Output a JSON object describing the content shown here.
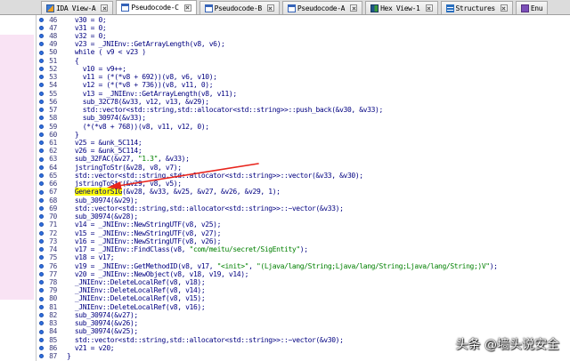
{
  "tabs": [
    {
      "label": "IDA View-A",
      "icon": "ida-view-icon",
      "active": false,
      "closable": true
    },
    {
      "label": "Pseudocode-C",
      "icon": "pseudocode-icon",
      "active": true,
      "closable": true
    },
    {
      "label": "Pseudocode-B",
      "icon": "pseudocode-icon",
      "active": false,
      "closable": true
    },
    {
      "label": "Pseudocode-A",
      "icon": "pseudocode-icon",
      "active": false,
      "closable": true
    },
    {
      "label": "Hex View-1",
      "icon": "hex-view-icon",
      "active": false,
      "closable": true
    },
    {
      "label": "Structures",
      "icon": "structures-icon",
      "active": false,
      "closable": true
    },
    {
      "label": "Enu",
      "icon": "enums-icon",
      "active": false,
      "closable": false
    }
  ],
  "colors": {
    "code_text": "#000080",
    "line_number": "#3c3c7c",
    "string": "#008000",
    "identifier_highlight": "#ffff00",
    "statement_dot": "#2f6fde",
    "annotation_arrow": "#e8241c",
    "active_tab": "#ffffff"
  },
  "code": {
    "lines": [
      {
        "n": "46",
        "segs": [
          {
            "t": "  v30 = 0;"
          }
        ]
      },
      {
        "n": "47",
        "segs": [
          {
            "t": "  v31 = 0;"
          }
        ]
      },
      {
        "n": "48",
        "segs": [
          {
            "t": "  v32 = 0;"
          }
        ]
      },
      {
        "n": "49",
        "segs": [
          {
            "t": "  v23 = _JNIEnv::GetArrayLength(v8, v6);"
          }
        ]
      },
      {
        "n": "50",
        "segs": [
          {
            "t": "  while ( v9 < v23 )"
          }
        ]
      },
      {
        "n": "51",
        "segs": [
          {
            "t": "  {"
          }
        ]
      },
      {
        "n": "52",
        "segs": [
          {
            "t": "    v10 = v9++;"
          }
        ]
      },
      {
        "n": "53",
        "segs": [
          {
            "t": "    v11 = (*(*v8 + 692))(v8, v6, v10);"
          }
        ]
      },
      {
        "n": "54",
        "segs": [
          {
            "t": "    v12 = (*(*v8 + 736))(v8, v11, 0);"
          }
        ]
      },
      {
        "n": "55",
        "segs": [
          {
            "t": "    v13 = _JNIEnv::GetArrayLength(v8, v11);"
          }
        ]
      },
      {
        "n": "56",
        "segs": [
          {
            "t": "    sub_32C78(&v33, v12, v13, &v29);"
          }
        ]
      },
      {
        "n": "57",
        "segs": [
          {
            "t": "    std::vector<std::string,std::allocator<std::string>>::push_back(&v30, &v33);"
          }
        ]
      },
      {
        "n": "58",
        "segs": [
          {
            "t": "    sub_30974(&v33);"
          }
        ]
      },
      {
        "n": "59",
        "segs": [
          {
            "t": "    (*(*v8 + 768))(v8, v11, v12, 0);"
          }
        ]
      },
      {
        "n": "60",
        "segs": [
          {
            "t": "  }"
          }
        ]
      },
      {
        "n": "61",
        "segs": [
          {
            "t": "  v25 = &unk_5C114;"
          }
        ]
      },
      {
        "n": "62",
        "segs": [
          {
            "t": "  v26 = &unk_5C114;"
          }
        ]
      },
      {
        "n": "63",
        "segs": [
          {
            "t": "  sub_32FAC(&v27, "
          },
          {
            "t": "\"1.3\"",
            "kind": "string"
          },
          {
            "t": ", &v33);"
          }
        ]
      },
      {
        "n": "64",
        "segs": [
          {
            "t": "  jstringToStr(&v28, v8, v7);"
          }
        ]
      },
      {
        "n": "65",
        "segs": [
          {
            "t": "  std::vector<std::string,std::allocator<std::string>>::vector(&v33, &v30);"
          }
        ]
      },
      {
        "n": "66",
        "segs": [
          {
            "t": "  jstringToStr(&v29, v8, v5);"
          }
        ]
      },
      {
        "n": "67",
        "segs": [
          {
            "t": "  "
          },
          {
            "t": "GeneratorSIG",
            "kind": "highlight"
          },
          {
            "t": "(&v28, &v33, &v25, &v27, &v26, &v29, 1);"
          }
        ]
      },
      {
        "n": "68",
        "segs": [
          {
            "t": "  sub_30974(&v29);"
          }
        ]
      },
      {
        "n": "69",
        "segs": [
          {
            "t": "  std::vector<std::string,std::allocator<std::string>>::~vector(&v33);"
          }
        ]
      },
      {
        "n": "70",
        "segs": [
          {
            "t": "  sub_30974(&v28);"
          }
        ]
      },
      {
        "n": "71",
        "segs": [
          {
            "t": "  v14 = _JNIEnv::NewStringUTF(v8, v25);"
          }
        ]
      },
      {
        "n": "72",
        "segs": [
          {
            "t": "  v15 = _JNIEnv::NewStringUTF(v8, v27);"
          }
        ]
      },
      {
        "n": "73",
        "segs": [
          {
            "t": "  v16 = _JNIEnv::NewStringUTF(v8, v26);"
          }
        ]
      },
      {
        "n": "74",
        "segs": [
          {
            "t": "  v17 = _JNIEnv::FindClass(v8, "
          },
          {
            "t": "\"com/meitu/secret/SigEntity\"",
            "kind": "string"
          },
          {
            "t": ");"
          }
        ]
      },
      {
        "n": "75",
        "segs": [
          {
            "t": "  v18 = v17;"
          }
        ]
      },
      {
        "n": "76",
        "segs": [
          {
            "t": "  v19 = _JNIEnv::GetMethodID(v8, v17, "
          },
          {
            "t": "\"<init>\"",
            "kind": "string"
          },
          {
            "t": ", "
          },
          {
            "t": "\"(Ljava/lang/String;Ljava/lang/String;Ljava/lang/String;)V\"",
            "kind": "string"
          },
          {
            "t": ");"
          }
        ]
      },
      {
        "n": "77",
        "segs": [
          {
            "t": "  v20 = _JNIEnv::NewObject(v8, v18, v19, v14);"
          }
        ]
      },
      {
        "n": "78",
        "segs": [
          {
            "t": "  _JNIEnv::DeleteLocalRef(v8, v18);"
          }
        ]
      },
      {
        "n": "79",
        "segs": [
          {
            "t": "  _JNIEnv::DeleteLocalRef(v8, v14);"
          }
        ]
      },
      {
        "n": "80",
        "segs": [
          {
            "t": "  _JNIEnv::DeleteLocalRef(v8, v15);"
          }
        ]
      },
      {
        "n": "81",
        "segs": [
          {
            "t": "  _JNIEnv::DeleteLocalRef(v8, v16);"
          }
        ]
      },
      {
        "n": "82",
        "segs": [
          {
            "t": "  sub_30974(&v27);"
          }
        ]
      },
      {
        "n": "83",
        "segs": [
          {
            "t": "  sub_30974(&v26);"
          }
        ]
      },
      {
        "n": "84",
        "segs": [
          {
            "t": "  sub_30974(&v25);"
          }
        ]
      },
      {
        "n": "85",
        "segs": [
          {
            "t": "  std::vector<std::string,std::allocator<std::string>>::~vector(&v30);"
          }
        ]
      },
      {
        "n": "86",
        "segs": [
          {
            "t": "  v21 = v20;"
          }
        ]
      },
      {
        "n": "87",
        "segs": [
          {
            "t": "}"
          }
        ]
      }
    ]
  },
  "watermark": {
    "text": "头条 @墙头说安全"
  }
}
